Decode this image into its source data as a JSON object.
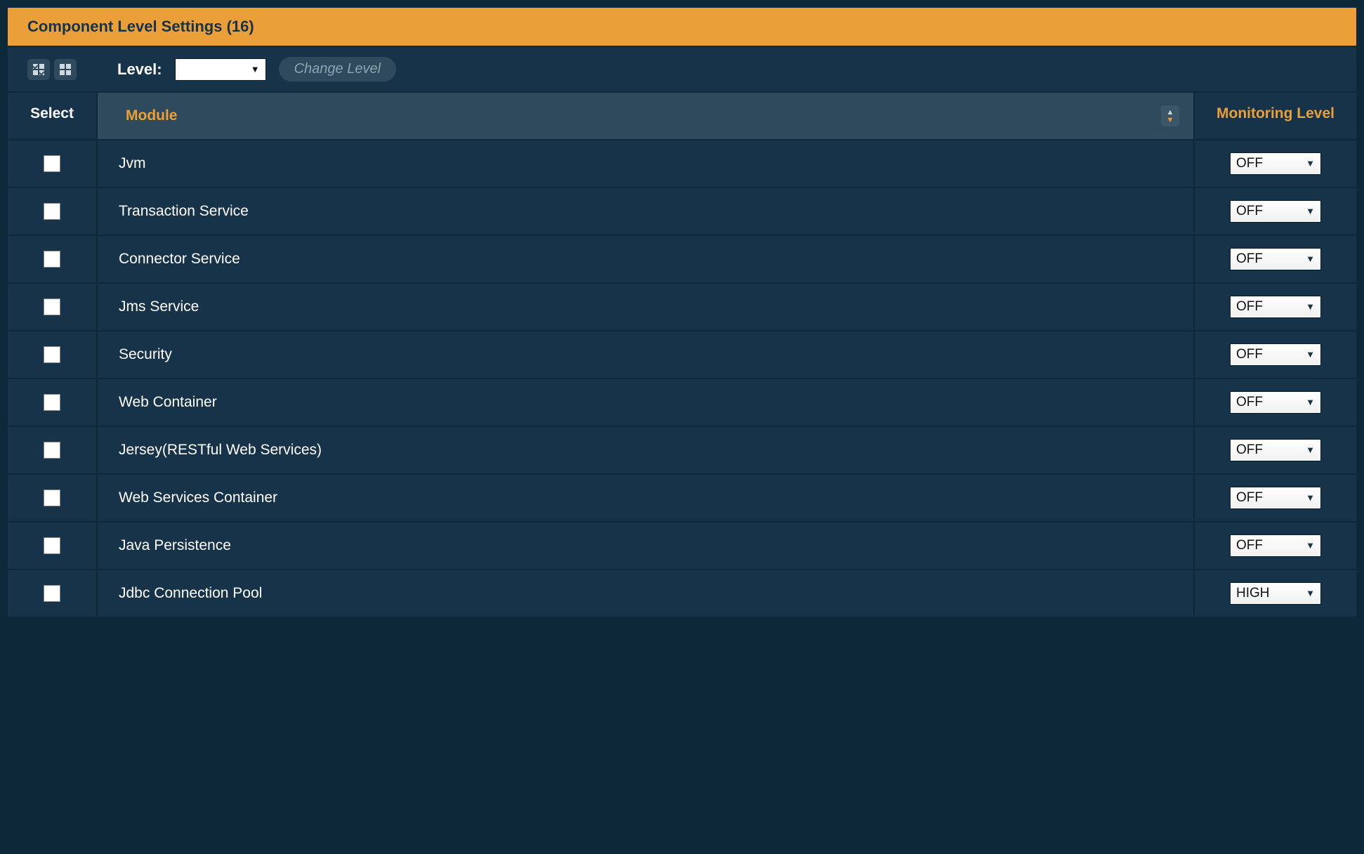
{
  "panel": {
    "title": "Component Level Settings (16)"
  },
  "toolbar": {
    "level_label": "Level:",
    "change_level_label": "Change Level"
  },
  "columns": {
    "select": "Select",
    "module": "Module",
    "monitoring_level": "Monitoring Level"
  },
  "rows": [
    {
      "module": "Jvm",
      "level": "OFF"
    },
    {
      "module": "Transaction Service",
      "level": "OFF"
    },
    {
      "module": "Connector Service",
      "level": "OFF"
    },
    {
      "module": "Jms Service",
      "level": "OFF"
    },
    {
      "module": "Security",
      "level": "OFF"
    },
    {
      "module": "Web Container",
      "level": "OFF"
    },
    {
      "module": "Jersey(RESTful Web Services)",
      "level": "OFF"
    },
    {
      "module": "Web Services Container",
      "level": "OFF"
    },
    {
      "module": "Java Persistence",
      "level": "OFF"
    },
    {
      "module": "Jdbc Connection Pool",
      "level": "HIGH"
    }
  ]
}
